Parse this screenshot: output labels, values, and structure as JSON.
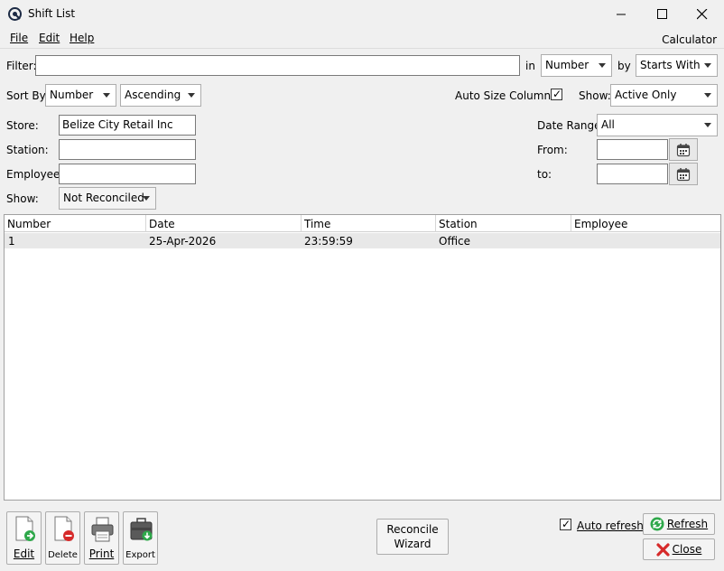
{
  "window": {
    "title": "Shift List"
  },
  "menu": {
    "file": "File",
    "edit": "Edit",
    "help": "Help",
    "calculator": "Calculator"
  },
  "filter": {
    "label": "Filter:",
    "value": "",
    "in_label": "in",
    "in_value": "Number",
    "by_label": "by",
    "by_value": "Starts With"
  },
  "sort": {
    "label": "Sort By:",
    "field": "Number",
    "order": "Ascending"
  },
  "auto_size": {
    "label": "Auto Size Columns",
    "checked": true
  },
  "show_top": {
    "label": "Show:",
    "value": "Active Only"
  },
  "store": {
    "label": "Store:",
    "value": "Belize City Retail Inc"
  },
  "station": {
    "label": "Station:",
    "value": ""
  },
  "employee": {
    "label": "Employee:",
    "value": ""
  },
  "show_filter": {
    "label": "Show:",
    "value": "Not Reconciled"
  },
  "date_range": {
    "label": "Date Range:",
    "value": "All"
  },
  "from": {
    "label": "From:",
    "value": ""
  },
  "to": {
    "label": "to:",
    "value": ""
  },
  "grid": {
    "columns": [
      "Number",
      "Date",
      "Time",
      "Station",
      "Employee"
    ],
    "rows": [
      {
        "number": "1",
        "date": "25-Apr-2026",
        "time": "23:59:59",
        "station": "Office",
        "employee": ""
      }
    ]
  },
  "toolbar": {
    "edit": "Edit",
    "delete": "Delete",
    "print": "Print",
    "export": "Export"
  },
  "reconcile": {
    "line1": "Reconcile",
    "line2": "Wizard"
  },
  "auto_refresh": {
    "label": "Auto refresh",
    "checked": true
  },
  "buttons": {
    "refresh": "Refresh",
    "close": "Close"
  },
  "icons": {
    "app": "app-logo-icon",
    "minimize": "minimize-icon",
    "maximize": "maximize-icon",
    "close": "close-icon",
    "calendar": "calendar-icon",
    "edit": "edit-document-icon",
    "delete": "delete-document-icon",
    "print": "printer-icon",
    "export": "export-briefcase-icon",
    "refresh": "refresh-icon",
    "close_btn": "red-x-icon"
  },
  "colors": {
    "selected_row": "#e8e8e8",
    "green": "#2ea84a",
    "red": "#d62a2a"
  }
}
